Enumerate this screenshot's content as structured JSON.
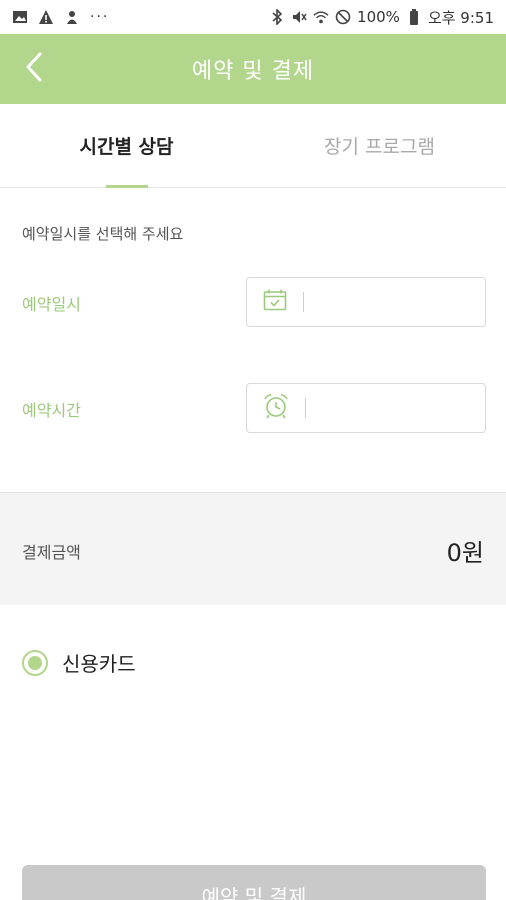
{
  "status_bar": {
    "left_icons": [
      "image-icon",
      "warning-icon",
      "app-notification-icon"
    ],
    "overflow": "···",
    "battery_percent": "100%",
    "time": "오후 9:51",
    "right_icons": [
      "bluetooth-icon",
      "mute-icon",
      "wifi-icon",
      "do-not-disturb-icon",
      "battery-icon"
    ]
  },
  "appbar": {
    "title": "예약 및 결제",
    "back_icon": "chevron-left-icon",
    "color": "#b3d68d"
  },
  "tabs": [
    {
      "label": "시간별 상담",
      "active": true
    },
    {
      "label": "장기 프로그램",
      "active": false
    }
  ],
  "form": {
    "instruction": "예약일시를 선택해 주세요",
    "date": {
      "label": "예약일시",
      "icon": "calendar-icon",
      "value": ""
    },
    "time": {
      "label": "예약시간",
      "icon": "alarm-clock-icon",
      "value": ""
    }
  },
  "payment": {
    "amount_label": "결제금액",
    "amount_value": "0원",
    "method_label": "신용카드",
    "method_selected": true
  },
  "submit": {
    "label": "예약 및 결제",
    "enabled": false
  },
  "colors": {
    "accent": "#b3d68d",
    "label_green": "#9cc97b",
    "disabled_button": "#c9c9c9"
  }
}
